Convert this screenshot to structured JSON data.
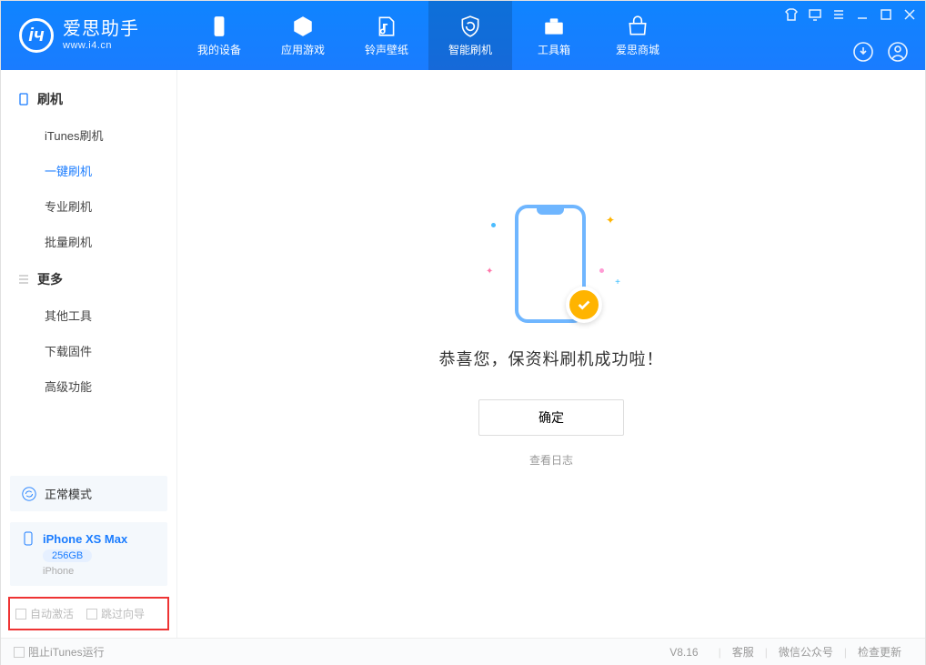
{
  "header": {
    "logo_title": "爱思助手",
    "logo_sub": "www.i4.cn",
    "nav": [
      {
        "label": "我的设备",
        "icon": "device"
      },
      {
        "label": "应用游戏",
        "icon": "cube"
      },
      {
        "label": "铃声壁纸",
        "icon": "music"
      },
      {
        "label": "智能刷机",
        "icon": "refresh",
        "active": true
      },
      {
        "label": "工具箱",
        "icon": "toolbox"
      },
      {
        "label": "爱思商城",
        "icon": "shop"
      }
    ]
  },
  "sidebar": {
    "group1": {
      "title": "刷机"
    },
    "items1": [
      {
        "label": "iTunes刷机"
      },
      {
        "label": "一键刷机",
        "active": true
      },
      {
        "label": "专业刷机"
      },
      {
        "label": "批量刷机"
      }
    ],
    "group2": {
      "title": "更多"
    },
    "items2": [
      {
        "label": "其他工具"
      },
      {
        "label": "下载固件"
      },
      {
        "label": "高级功能"
      }
    ],
    "mode": {
      "label": "正常模式"
    },
    "device": {
      "name": "iPhone XS Max",
      "capacity": "256GB",
      "type": "iPhone"
    },
    "check_auto_activate": "自动激活",
    "check_skip_guide": "跳过向导"
  },
  "main": {
    "success_message": "恭喜您，保资料刷机成功啦！",
    "confirm_label": "确定",
    "view_log_label": "查看日志"
  },
  "footer": {
    "block_itunes_label": "阻止iTunes运行",
    "version": "V8.16",
    "links": {
      "support": "客服",
      "wechat": "微信公众号",
      "check_update": "检查更新"
    }
  }
}
